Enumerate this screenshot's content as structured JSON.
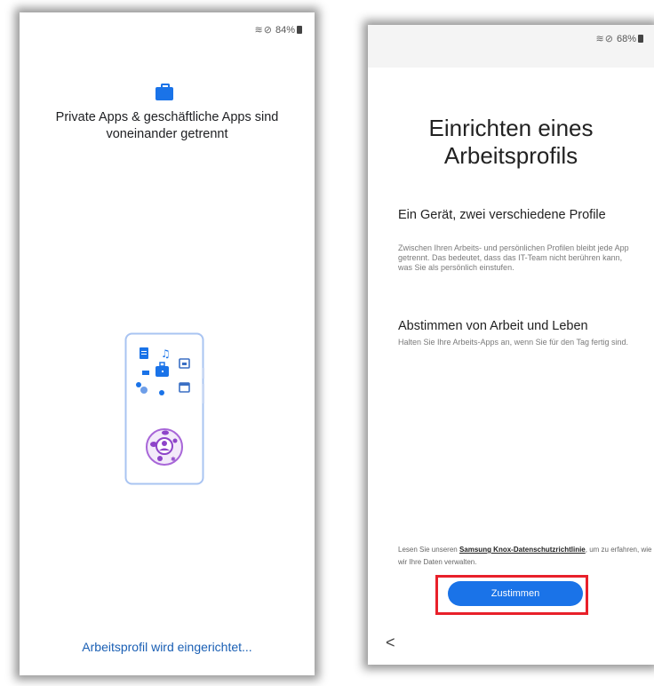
{
  "left_screen": {
    "status": {
      "icons": "wifi-icon dnd-icon",
      "battery": "84%"
    },
    "icon": "briefcase-icon",
    "title": "Private Apps & geschäftliche Apps sind voneinander getrennt",
    "progress_text": "Arbeitsprofil wird eingerichtet..."
  },
  "right_screen": {
    "status": {
      "icons": "wifi-icon dnd-icon",
      "battery": "68%"
    },
    "title": "Einrichten eines Arbeitsprofils",
    "sections": [
      {
        "heading": "Ein Gerät, zwei verschiedene Profile",
        "body": "Zwischen Ihren Arbeits- und persönlichen Profilen bleibt jede App getrennt. Das bedeutet, dass das IT-Team nicht berühren kann, was Sie als persönlich einstufen."
      },
      {
        "heading": "Abstimmen von Arbeit und Leben",
        "body": "Halten Sie Ihre Arbeits-Apps an, wenn Sie für den Tag fertig sind."
      }
    ],
    "privacy_prefix": "Lesen Sie unseren",
    "privacy_link": "Samsung Knox-Datenschutzrichtlinie",
    "privacy_suffix": ", um zu erfahren, wie wir Ihre Daten verwalten.",
    "agree_button": "Zustimmen",
    "back": "<"
  },
  "colors": {
    "accent": "#1a73e8",
    "highlight": "#e8202a",
    "illustration_purple": "#8e44c9"
  }
}
